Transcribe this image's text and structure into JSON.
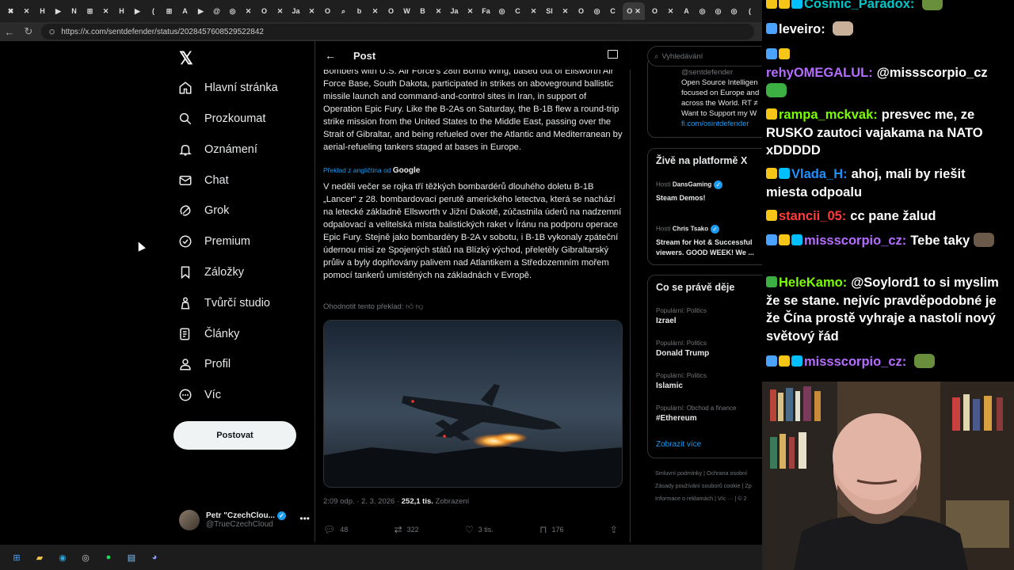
{
  "browser": {
    "url": "https://x.com/sentdefender/status/2028457608529522842",
    "tab_glyphs": [
      "✖",
      "✕",
      "H",
      "▶",
      "N",
      "⊞",
      "✕",
      "H",
      "▶",
      "(",
      "⊞",
      "A",
      "▶",
      "@",
      "◎",
      "✕",
      "O",
      "✕",
      "Ja",
      "✕",
      "O",
      "⌕",
      "b",
      "✕",
      "O",
      "W",
      "B",
      "✕",
      "Ja",
      "✕",
      "Fa",
      "◎",
      "C",
      "✕",
      "Sl",
      "✕",
      "O",
      "◎",
      "C",
      "O",
      "✕",
      "A",
      "◎",
      "◎",
      "◎",
      "(",
      "✕",
      "F",
      "◎",
      "✕",
      "O",
      "✕",
      "O",
      "✉",
      "✕",
      "O",
      "✕",
      "Fa",
      "✕",
      "O",
      "C"
    ],
    "active_tab": "O"
  },
  "x": {
    "logo": "𝕏",
    "nav": [
      {
        "label": "Hlavní stránka",
        "icon": "home-icon"
      },
      {
        "label": "Prozkoumat",
        "icon": "search-icon"
      },
      {
        "label": "Oznámení",
        "icon": "bell-icon"
      },
      {
        "label": "Chat",
        "icon": "mail-icon"
      },
      {
        "label": "Grok",
        "icon": "grok-icon"
      },
      {
        "label": "Premium",
        "icon": "premium-icon"
      },
      {
        "label": "Záložky",
        "icon": "bookmark-icon"
      },
      {
        "label": "Tvůrčí studio",
        "icon": "studio-icon"
      },
      {
        "label": "Články",
        "icon": "articles-icon"
      },
      {
        "label": "Profil",
        "icon": "user-icon"
      },
      {
        "label": "Víc",
        "icon": "more-icon"
      }
    ],
    "post_button": "Postovat",
    "profile": {
      "name": "Petr \"CzechClou...",
      "handle": "@TrueCzechCloud",
      "more": "•••"
    },
    "header": {
      "back": "←",
      "title": "Post"
    },
    "post": {
      "english": "Bombers with U.S. Air Force's 28th Bomb Wing, based out of Ellsworth Air Force Base, South Dakota, participated in strikes on aboveground ballistic missile launch and command-and-control sites in Iran, in support of Operation Epic Fury. Like the B-2As on Saturday, the B-1B flew a round-trip strike mission from the United States to the Middle East, passing over the Strait of Gibraltar, and being refueled over the Atlantic and Mediterranean by aerial-refueling tankers staged at bases in Europe.",
      "translated_by": "Překlad z angličtina od",
      "translator": "Google",
      "czech": "V neděli večer se rojka tří těžkých bombardérů dlouhého doletu B-1B „Lancer“ z 28. bombardovací perutě amerického letectva, která se nachází na letecké základně Ellsworth v Jižní Dakotě, zúčastnila úderů na nadzemní odpalovací a velitelská místa balistických raket v Íránu na podporu operace Epic Fury. Stejně jako bombardéry B-2A v sobotu, i B-1B vykonaly zpáteční údernou misi ze Spojených států na Blízký východ, přeletěly Gibraltarský průliv a byly doplňovány palivem nad Atlantikem a Středozemním mořem pomocí tankerů umístěných na základnách v Evropě.",
      "rate_translation": "Ohodnotit tento překlad:",
      "time": "2:09 odp. · 2. 3. 2026 ·",
      "views": "252,1 tis.",
      "views_label": "Zobrazení",
      "replies": "48",
      "reposts": "322",
      "likes": "3 tis.",
      "bookmarks": "176"
    },
    "search_placeholder": "Vyhledávání",
    "bio": {
      "handle": "@sentdefender",
      "lines": [
        "Open Source Intelligen",
        "focused on Europe and",
        "across the World. RT ≠",
        "Want to Support my W"
      ],
      "link": "fi.com/osintdefender"
    },
    "live": {
      "title": "Živě na platformě X",
      "items": [
        {
          "host_label": "Hostí",
          "host": "DansGaming",
          "title1": "Steam Demos!",
          "title2": ""
        },
        {
          "host_label": "Hostí",
          "host": "Chris Tsako",
          "title1": "Stream for Hot & Successful",
          "title2": "viewers. GOOD WEEK! We ..."
        }
      ]
    },
    "trends": {
      "title": "Co se právě děje",
      "items": [
        {
          "category": "Populární: Politics",
          "name": "Izrael"
        },
        {
          "category": "Populární: Politics",
          "name": "Donald Trump"
        },
        {
          "category": "Populární: Politics",
          "name": "Islamic"
        },
        {
          "category": "Populární: Obchod a finance",
          "name": "#Ethereum"
        }
      ],
      "show_more": "Zobrazit více"
    },
    "footer": [
      "Smluvní podmínky  |  Ochrana osobní",
      "Zásady používání souborů cookie  |  Zp",
      "Informace o reklamách  |  Víc ···  |  © 2"
    ]
  },
  "chat": {
    "messages": [
      {
        "user": "Cosmic_Paradox:",
        "user_color": "#00c8c8",
        "text": "",
        "badges": [
          "#f5c518",
          "#f5c518",
          "#00bfff"
        ],
        "emote": "#6a8f3c"
      },
      {
        "user": "leveiro:",
        "user_color": "#ffffff",
        "text": "",
        "badges": [
          "#4ba3ff"
        ],
        "emote": "#c9b09a"
      },
      {
        "user": "",
        "user_color": "#ffffff",
        "text": "",
        "badges": [
          "#4ba3ff",
          "#f5c518"
        ],
        "emote": ""
      },
      {
        "user": "rehyOMEGALUL:",
        "user_color": "#b66cff",
        "text": "@missscorpio_cz",
        "badges": [],
        "emote": "#3cb043"
      },
      {
        "user": "rampa_mckvak:",
        "user_color": "#7cfc00",
        "text": "presvec me, ze RUSKO zautoci vajakama na NATO xDDDDD",
        "badges": [
          "#f5c518"
        ],
        "emote": ""
      },
      {
        "user": "Vlada_H:",
        "user_color": "#1e90ff",
        "text": "ahoj, mali by riešit miesta odpoalu",
        "badges": [
          "#f5c518",
          "#00bfff"
        ],
        "emote": ""
      },
      {
        "user": "stancii_05:",
        "user_color": "#ff3b3b",
        "text": "cc pane žalud",
        "badges": [
          "#f5c518"
        ],
        "emote": ""
      },
      {
        "user": "missscorpio_cz:",
        "user_color": "#b66cff",
        "text": "Tebe taky",
        "badges": [
          "#4ba3ff",
          "#f5c518",
          "#00bfff"
        ],
        "emote": "#6b5a4a"
      },
      {
        "user": "HeleKamo:",
        "user_color": "#7cfc00",
        "text": "@Soylord1 to si myslim že se stane. nejvíc pravděpodobné je že Čína prostě vyhraje a nastolí nový světový řád",
        "badges": [
          "#3cb043"
        ],
        "emote": ""
      },
      {
        "user": "missscorpio_cz:",
        "user_color": "#b66cff",
        "text": "",
        "badges": [
          "#4ba3ff",
          "#f5c518",
          "#00bfff"
        ],
        "emote": "#6a8f3c"
      }
    ]
  },
  "taskbar": {
    "apps": [
      {
        "name": "windows-start-icon",
        "glyph": "⊞",
        "color": "#4aa3ff"
      },
      {
        "name": "file-explorer-icon",
        "glyph": "▰",
        "color": "#f2c744"
      },
      {
        "name": "edge-browser-icon",
        "glyph": "◉",
        "color": "#2fa6d8"
      },
      {
        "name": "chrome-browser-icon",
        "glyph": "◎",
        "color": "#cccccc"
      },
      {
        "name": "spotify-icon",
        "glyph": "●",
        "color": "#1ed760"
      },
      {
        "name": "notepad-icon",
        "glyph": "▤",
        "color": "#7fc4ff"
      },
      {
        "name": "discord-icon",
        "glyph": "◕",
        "color": "#8c9eff"
      }
    ]
  }
}
